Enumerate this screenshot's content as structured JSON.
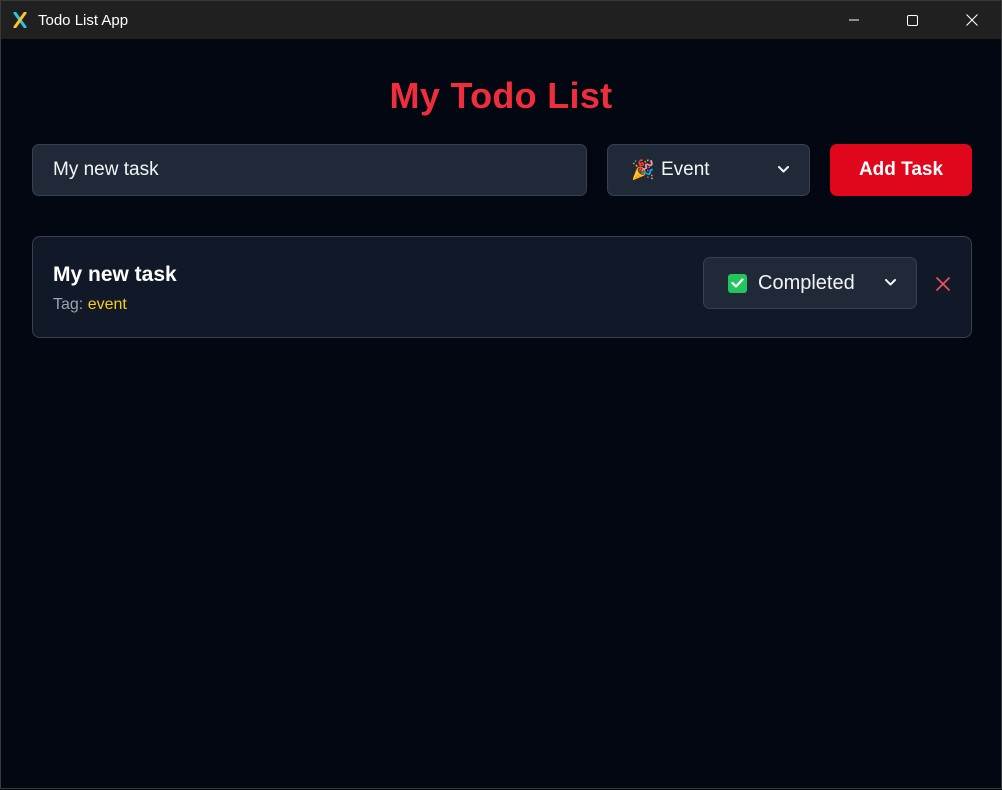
{
  "window": {
    "title": "Todo List App",
    "icon": "tauri-app-icon"
  },
  "page": {
    "title": "My Todo List"
  },
  "form": {
    "input_value": "My new task",
    "tag_select": {
      "emoji": "🎉",
      "selected": "Event"
    },
    "add_label": "Add Task"
  },
  "todos": [
    {
      "title": "My new task",
      "tag_prefix": "Tag:",
      "tag": "event",
      "status": "Completed",
      "status_icon": "check-box-icon"
    }
  ],
  "colors": {
    "accent": "#ef2d3d",
    "button": "#e0061c",
    "tag": "#facc15",
    "completed": "#22c55e"
  }
}
